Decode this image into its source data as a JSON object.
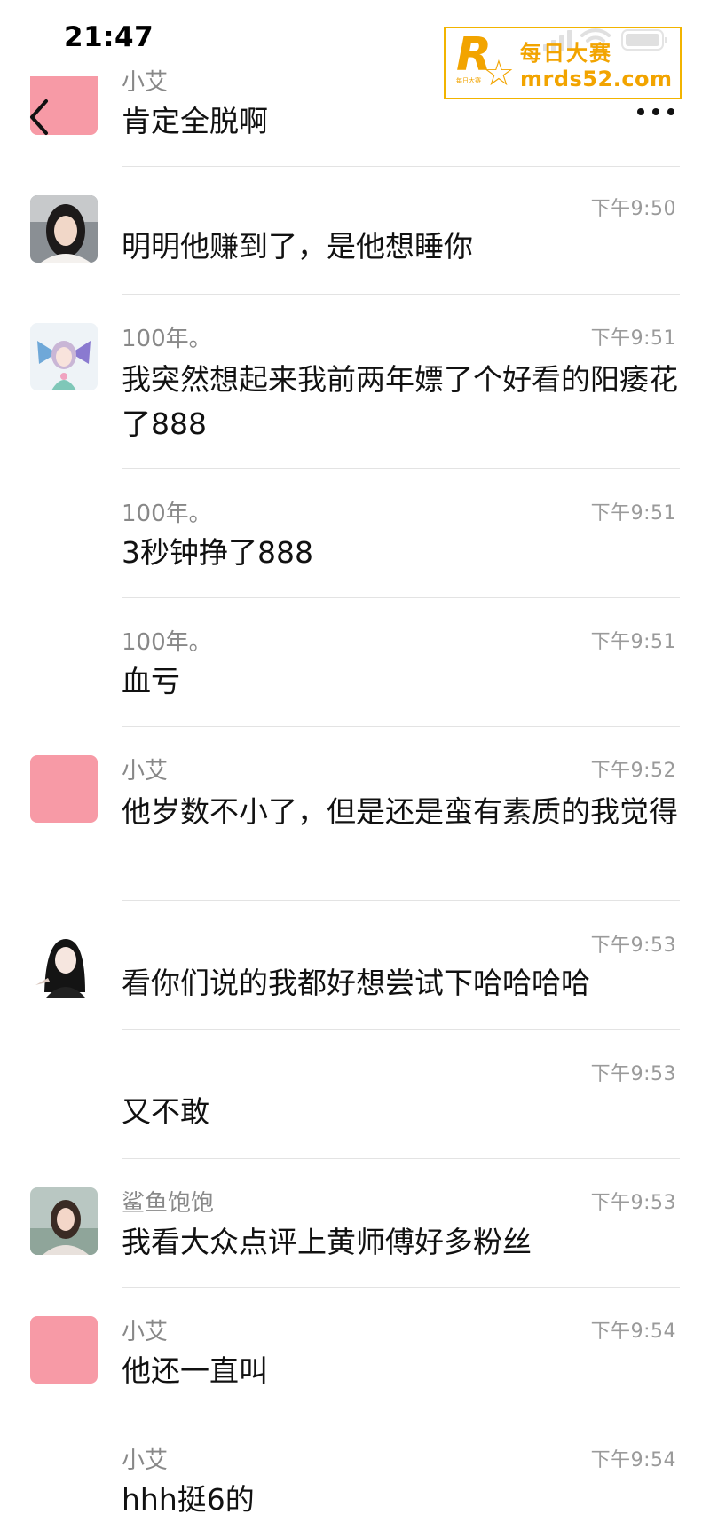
{
  "status_bar": {
    "time": "21:47"
  },
  "watermark": {
    "cn": "每日大赛",
    "en": "mrds52.com",
    "logo_letter": "R",
    "logo_small": "每日大赛"
  },
  "header": {
    "partial_sender": "小艾",
    "partial_text": "肯定全脱啊"
  },
  "messages": [
    {
      "sender": "",
      "time": "下午9:50",
      "text": "明明他赚到了，是他想睡你",
      "avatar": "photo-woman-car"
    },
    {
      "sender": "100年。",
      "time": "下午9:51",
      "text": "我突然想起来我前两年嫖了个好看的阳痿花了888",
      "avatar": "illustration-butterfly-girl"
    },
    {
      "sender": "100年。",
      "time": "下午9:51",
      "text": "3秒钟挣了888",
      "avatar": ""
    },
    {
      "sender": "100年。",
      "time": "下午9:51",
      "text": "血亏",
      "avatar": ""
    },
    {
      "sender": "小艾",
      "time": "下午9:52",
      "text": "他岁数不小了，但是还是蛮有素质的我觉得",
      "avatar": "pink-square"
    },
    {
      "sender": "",
      "time": "下午9:53",
      "text": "看你们说的我都好想尝试下哈哈哈哈",
      "avatar": "illustration-black-hair-girl"
    },
    {
      "sender": "",
      "time": "下午9:53",
      "text": "又不敢",
      "avatar": ""
    },
    {
      "sender": "鲨鱼饱饱",
      "time": "下午9:53",
      "text": "我看大众点评上黄师傅好多粉丝",
      "avatar": "photo-woman-outdoor"
    },
    {
      "sender": "小艾",
      "time": "下午9:54",
      "text": "他还一直叫",
      "avatar": "pink-square"
    },
    {
      "sender": "小艾",
      "time": "下午9:54",
      "text": "hhh挺6的",
      "avatar": ""
    }
  ],
  "colors": {
    "pink_avatar": "#f79aa6",
    "timestamp": "#9a9a9a",
    "sender": "#888888",
    "watermark": "#f2a400"
  }
}
